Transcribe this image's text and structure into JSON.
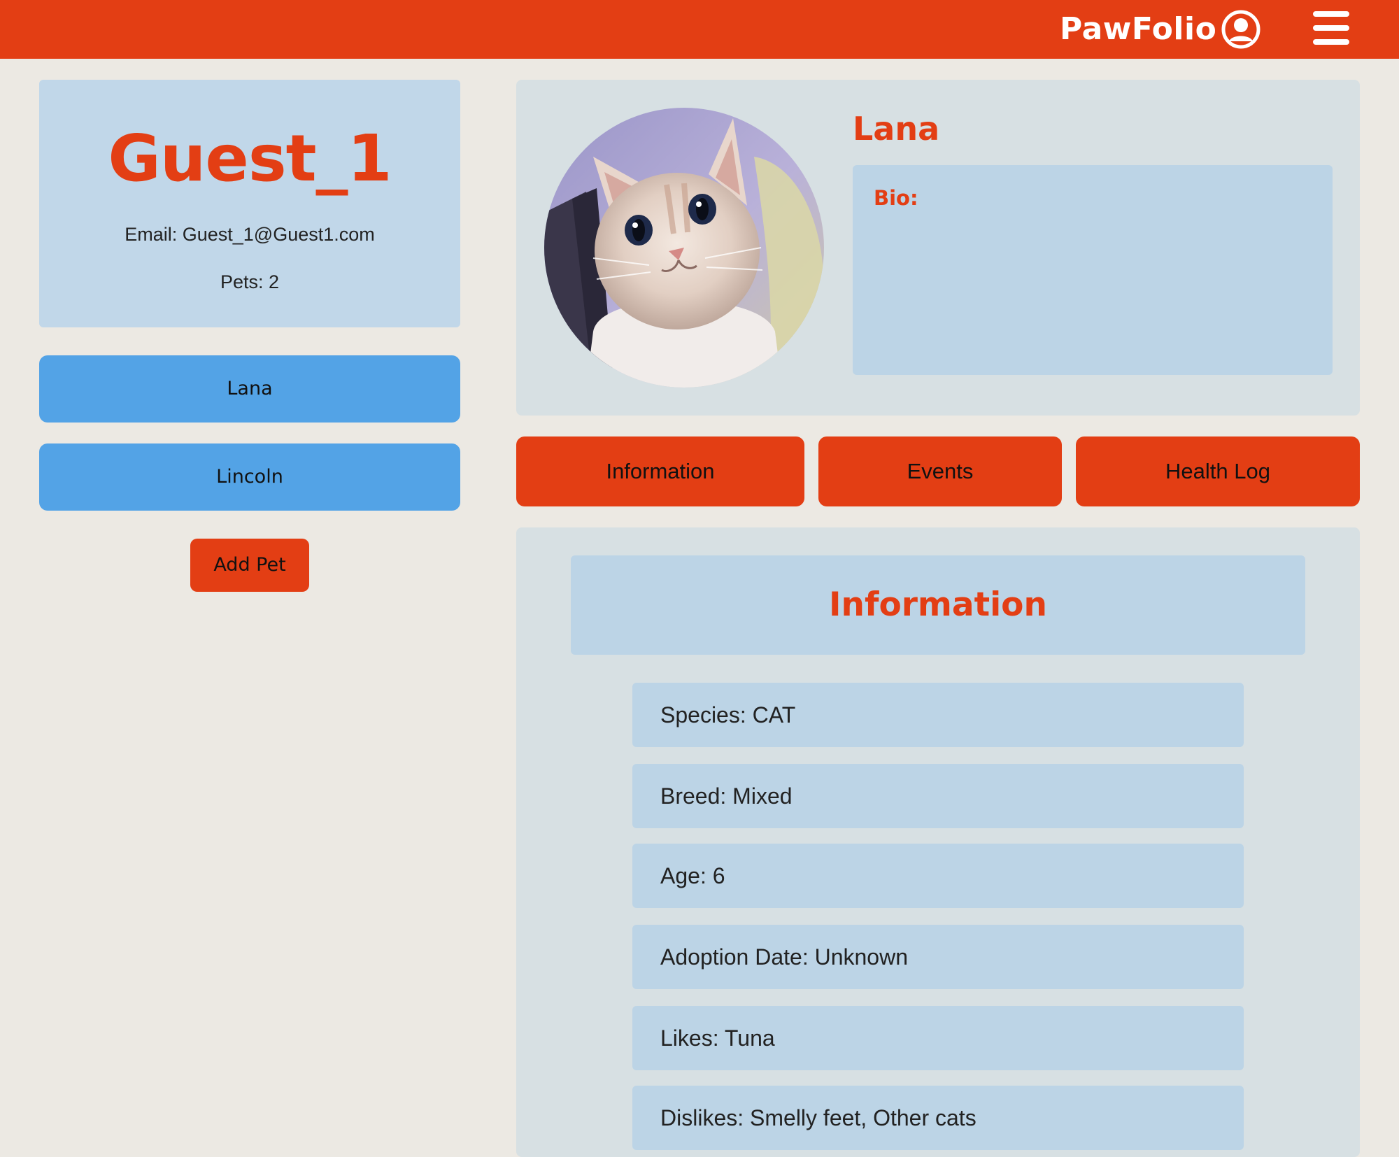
{
  "header": {
    "brand": "PawFolio",
    "brand_color": "#E33E14",
    "account_icon": "user-circle-icon",
    "menu_icon": "hamburger-menu-icon"
  },
  "user": {
    "name": "Guest_1",
    "email": "Email: Guest_1@Guest1.com",
    "pets": "Pets: 2"
  },
  "pet_list": [
    {
      "label": "Lana"
    },
    {
      "label": "Lincoln"
    }
  ],
  "add_pet_label": "Add Pet",
  "pet": {
    "name": "Lana",
    "bio_label": "Bio:",
    "photo": "cat-photo"
  },
  "tabs": [
    {
      "label": "Information"
    },
    {
      "label": "Events"
    },
    {
      "label": "Health Log"
    }
  ],
  "info": {
    "title": "Information",
    "rows": [
      {
        "text": "Species: CAT"
      },
      {
        "text": "Breed: Mixed"
      },
      {
        "text": "Age: 6"
      },
      {
        "text": "Adoption Date: Unknown"
      },
      {
        "text": "Likes: Tuna"
      },
      {
        "text": "Dislikes: Smelly feet, Other cats"
      }
    ]
  }
}
